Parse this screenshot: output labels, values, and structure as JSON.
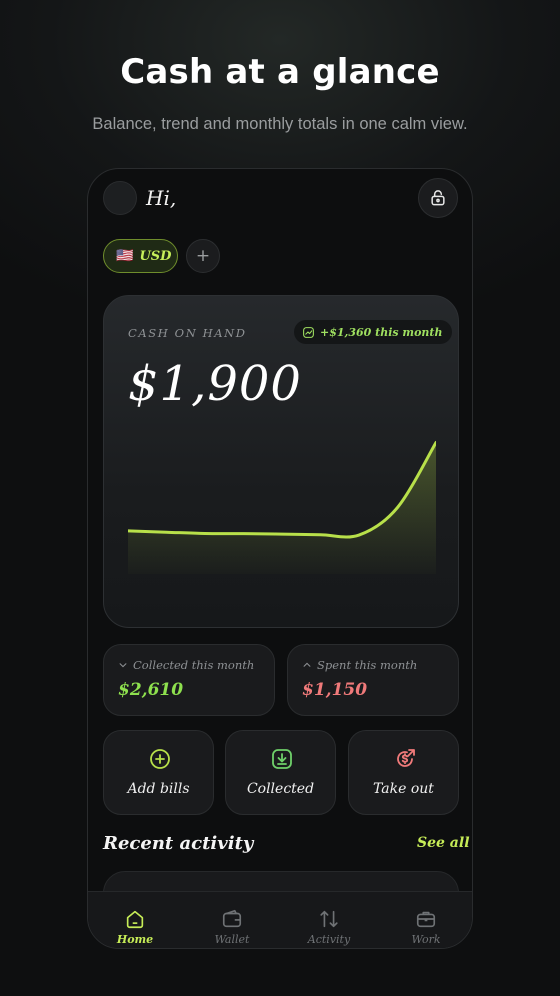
{
  "hero": {
    "title": "Cash at a glance",
    "subtitle": "Balance, trend and monthly totals in one calm view."
  },
  "header": {
    "greeting": "Hi,",
    "lock_icon": "lock-icon"
  },
  "currency": {
    "flag": "🇺🇸",
    "code": "USD",
    "add_label": "+"
  },
  "cash_card": {
    "label": "CASH ON HAND",
    "trend_text": "+$1,360 this month",
    "amount": "$1,900"
  },
  "chart_data": {
    "type": "area",
    "title": "",
    "xlabel": "",
    "ylabel": "",
    "series": [
      {
        "values": [
          540,
          520,
          500,
          498,
          490,
          480,
          476,
          900,
          1900
        ]
      }
    ],
    "ylim": [
      0,
      2000
    ],
    "grid": false,
    "color": "#b8e04a"
  },
  "stats": {
    "collected": {
      "label": "Collected this month",
      "value": "$2,610",
      "color": "#8ee04e"
    },
    "spent": {
      "label": "Spent this month",
      "value": "$1,150",
      "color": "#f07a7a"
    }
  },
  "actions": [
    {
      "label": "Add bills",
      "icon": "plus-circle-icon",
      "color": "#b8e04a"
    },
    {
      "label": "Collected",
      "icon": "download-icon",
      "color": "#6fd06a"
    },
    {
      "label": "Take out",
      "icon": "dollar-out-icon",
      "color": "#f07a7a"
    }
  ],
  "recent": {
    "title": "Recent activity",
    "see_all": "See all"
  },
  "tabs": [
    {
      "label": "Home",
      "icon": "home-icon",
      "active": true
    },
    {
      "label": "Wallet",
      "icon": "wallet-icon",
      "active": false
    },
    {
      "label": "Activity",
      "icon": "arrows-icon",
      "active": false
    },
    {
      "label": "Work",
      "icon": "briefcase-icon",
      "active": false
    }
  ],
  "colors": {
    "accent": "#c6ec57",
    "background": "#0d0e0f"
  }
}
